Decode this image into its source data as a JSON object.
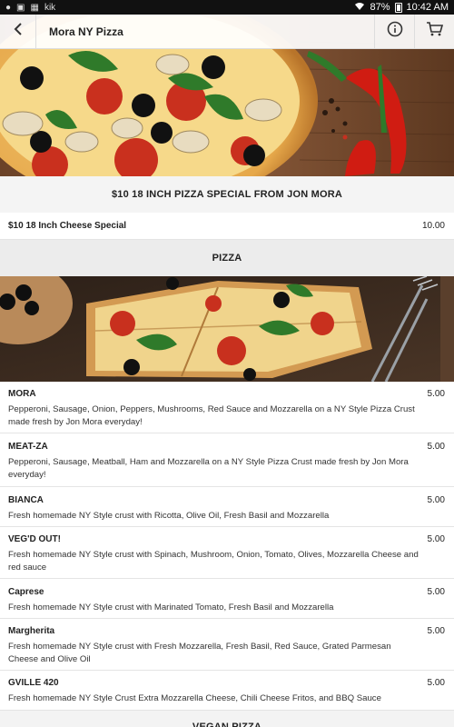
{
  "status_bar": {
    "left_icons": [
      "notification-icon",
      "image-icon",
      "grid-icon",
      "kik-icon"
    ],
    "kik_label": "kik",
    "battery": "87%",
    "time": "10:42 AM"
  },
  "header": {
    "title": "Mora NY Pizza",
    "back_icon": "back-arrow-icon",
    "info_icon": "info-icon",
    "cart_icon": "cart-icon"
  },
  "sections": [
    {
      "title": "$10 18 INCH PIZZA SPECIAL FROM JON MORA",
      "items": [
        {
          "name": "$10 18 Inch Cheese Special",
          "price": "10.00",
          "description": ""
        }
      ]
    },
    {
      "title": "PIZZA",
      "items": [
        {
          "name": "MORA",
          "price": "5.00",
          "description": "Pepperoni, Sausage, Onion, Peppers, Mushrooms, Red Sauce and Mozzarella on a NY Style Pizza Crust made fresh by Jon Mora everyday!"
        },
        {
          "name": "MEAT-ZA",
          "price": "5.00",
          "description": "Pepperoni, Sausage, Meatball, Ham and Mozzarella on a NY Style Pizza Crust made fresh by Jon Mora everyday!"
        },
        {
          "name": "BIANCA",
          "price": "5.00",
          "description": "Fresh homemade NY Style crust with Ricotta, Olive Oil, Fresh Basil and Mozzarella"
        },
        {
          "name": "VEG'D OUT!",
          "price": "5.00",
          "description": "Fresh homemade NY Style crust with Spinach, Mushroom, Onion, Tomato, Olives, Mozzarella Cheese and red sauce"
        },
        {
          "name": "Caprese",
          "price": "5.00",
          "description": "Fresh homemade NY Style crust with Marinated Tomato, Fresh Basil and Mozzarella"
        },
        {
          "name": "Margherita",
          "price": "5.00",
          "description": "Fresh homemade NY Style crust with Fresh Mozzarella, Fresh Basil, Red Sauce, Grated Parmesan Cheese and Olive Oil"
        },
        {
          "name": "GVILLE 420",
          "price": "5.00",
          "description": "Fresh homemade NY Style Crust Extra Mozzarella Cheese, Chili Cheese Fritos, and BBQ Sauce"
        }
      ]
    },
    {
      "title": "VEGAN PIZZA",
      "items": []
    }
  ]
}
